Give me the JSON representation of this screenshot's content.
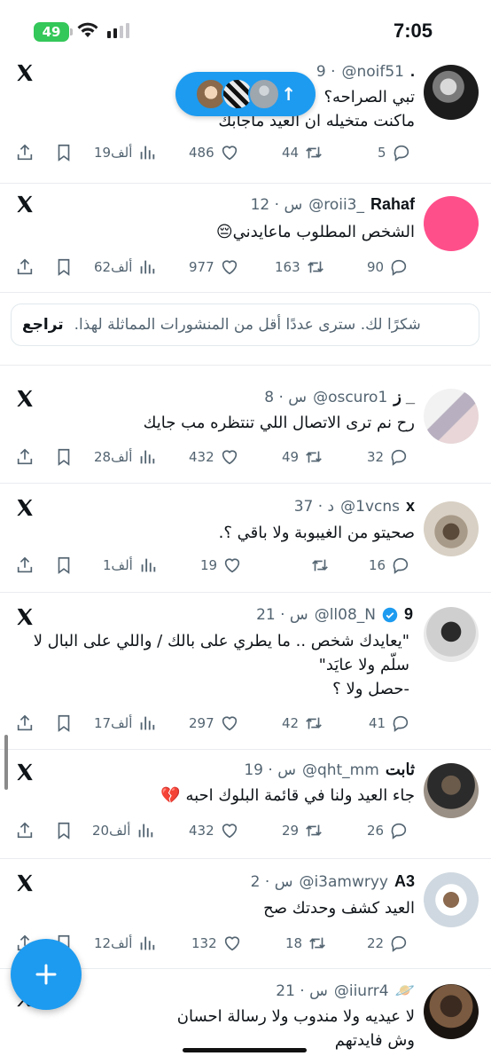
{
  "status_bar": {
    "time": "7:05",
    "battery": "49"
  },
  "new_posts_pill": {
    "arrow": "↑",
    "icon": "arrow-up-icon"
  },
  "feed": {
    "tweets": [
      {
        "name": ".",
        "handle": "@noif51",
        "time": "9 ·",
        "lines": [
          "تبي الصراحه؟ ",
          "ماكنت متخيله ان العيد ماجابك"
        ],
        "reply_count": "5",
        "retweet_count": "44",
        "like_count": "486",
        "views_count": "19ألف"
      },
      {
        "name": "Rahaf",
        "handle": "@roii3_",
        "time": "12 · س",
        "lines": [
          "الشخص المطلوب ماعايدني😔"
        ],
        "reply_count": "90",
        "retweet_count": "163",
        "like_count": "977",
        "views_count": "62ألف"
      }
    ],
    "notice": {
      "text": "شكرًا لك. سترى عددًا أقل من المنشورات المماثلة لهذا.",
      "undo_label": "تراجع"
    },
    "tweets2": [
      {
        "name": "ز _",
        "handle": "@oscuro1",
        "time": "8 · س",
        "lines": [
          "رح نم ترى الاتصال اللي تنتظره مب جايك"
        ],
        "reply_count": "32",
        "retweet_count": "49",
        "like_count": "432",
        "views_count": "28ألف"
      },
      {
        "name": "x",
        "handle": "@1vcns",
        "time": "37 · د",
        "lines": [
          "صحيتو من الغيبوبة ولا باقي ؟."
        ],
        "reply_count": "16",
        "retweet_count": "",
        "like_count": "19",
        "views_count": "1ألف"
      },
      {
        "name": "9",
        "handle": "@ll08_N",
        "time": "21 · س",
        "lines": [
          "\"يعايدك شخص .. ما يطري على بالك / واللي على البال لا",
          "سلّم ولا عايَد\"",
          "-حصل ولا ؟"
        ],
        "reply_count": "41",
        "retweet_count": "42",
        "like_count": "297",
        "views_count": "17ألف"
      },
      {
        "name": "ثابت",
        "handle": "@qht_mm",
        "time": "19 · س",
        "lines": [
          "جاء العيد ولنا في قائمة البلوك احبه 💔"
        ],
        "reply_count": "26",
        "retweet_count": "29",
        "like_count": "432",
        "views_count": "20ألف"
      },
      {
        "name": "A3",
        "handle": "@i3amwryy",
        "time": "2 · س",
        "lines": [
          "العيد كشف وحدتك صح"
        ],
        "reply_count": "22",
        "retweet_count": "18",
        "like_count": "132",
        "views_count": "12ألف"
      },
      {
        "name": "🪐",
        "handle": "@iiurr4",
        "time": "21 · س",
        "lines": [
          "لا عيديه ولا مندوب ولا رسالة احسان",
          "وش فايدتهم"
        ]
      }
    ]
  },
  "fab": {
    "label": "+"
  },
  "colors": {
    "accent": "#1d9bf0",
    "text": "#0f1419",
    "muted": "#536471",
    "battery": "#34c759"
  }
}
